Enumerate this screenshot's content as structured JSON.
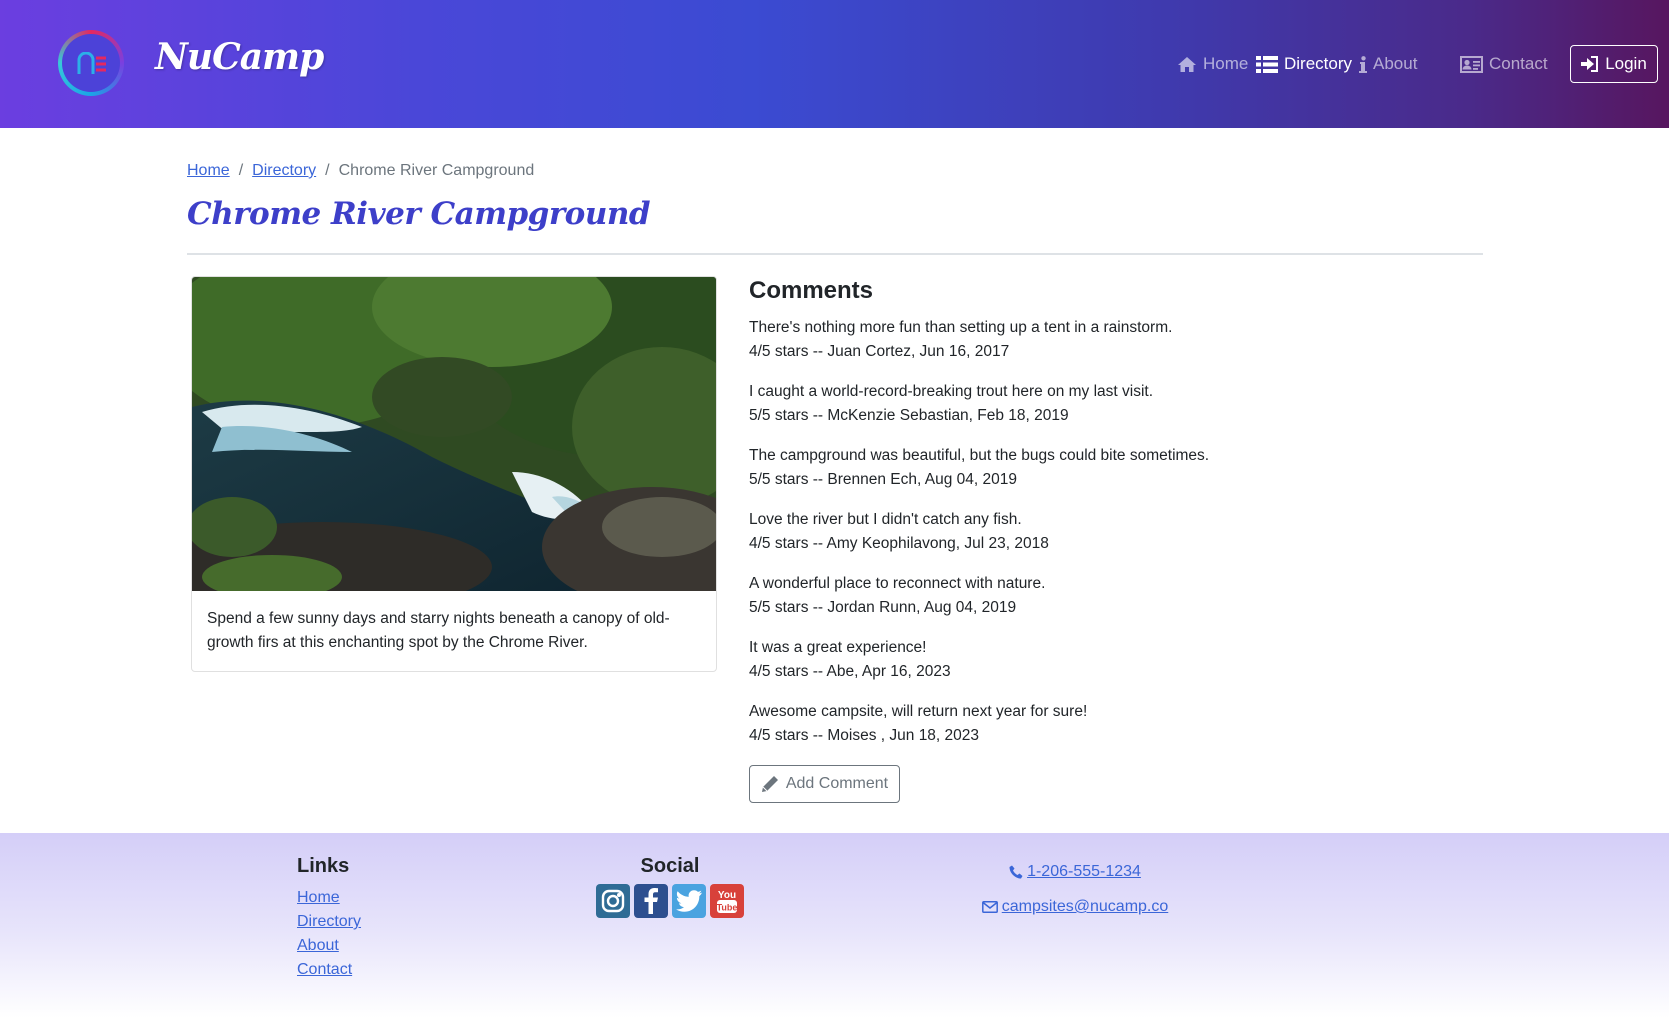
{
  "brand": {
    "name": "NuCamp"
  },
  "nav": {
    "items": [
      {
        "label": "Home",
        "icon": "home-icon",
        "active": false
      },
      {
        "label": "Directory",
        "icon": "list-icon",
        "active": true
      },
      {
        "label": "About",
        "icon": "info-icon",
        "active": false
      },
      {
        "label": "Contact",
        "icon": "address-card-icon",
        "active": false
      }
    ],
    "login_label": "Login"
  },
  "breadcrumb": {
    "home": "Home",
    "directory": "Directory",
    "current": "Chrome River Campground",
    "separator": "/"
  },
  "campsite": {
    "name": "Chrome River Campground",
    "description": "Spend a few sunny days and starry nights beneath a canopy of old-growth firs at this enchanting spot by the Chrome River."
  },
  "comments": {
    "heading": "Comments",
    "items": [
      {
        "text": "There's nothing more fun than setting up a tent in a rainstorm.",
        "meta": "4/5 stars -- Juan Cortez, Jun 16, 2017"
      },
      {
        "text": "I caught a world-record-breaking trout here on my last visit.",
        "meta": "5/5 stars -- McKenzie Sebastian, Feb 18, 2019"
      },
      {
        "text": "The campground was beautiful, but the bugs could bite sometimes.",
        "meta": "5/5 stars -- Brennen Ech, Aug 04, 2019"
      },
      {
        "text": "Love the river but I didn't catch any fish.",
        "meta": "4/5 stars -- Amy Keophilavong, Jul 23, 2018"
      },
      {
        "text": "A wonderful place to reconnect with nature.",
        "meta": "5/5 stars -- Jordan Runn, Aug 04, 2019"
      },
      {
        "text": "It was a great experience!",
        "meta": "4/5 stars -- Abe, Apr 16, 2023"
      },
      {
        "text": "Awesome campsite, will return next year for sure!",
        "meta": "4/5 stars -- Moises , Jun 18, 2023"
      }
    ],
    "add_label": "Add Comment"
  },
  "footer": {
    "links_heading": "Links",
    "links": [
      "Home",
      "Directory",
      "About",
      "Contact"
    ],
    "social_heading": "Social",
    "social": [
      {
        "name": "instagram-icon",
        "color": "#2f6c95"
      },
      {
        "name": "facebook-icon",
        "color": "#2d4f8f"
      },
      {
        "name": "twitter-icon",
        "color": "#4aa3e0"
      },
      {
        "name": "youtube-icon",
        "color": "#d8413a"
      }
    ],
    "phone": "1-206-555-1234",
    "email": "campsites@nucamp.co"
  },
  "colors": {
    "accent": "#3d3fc9",
    "link": "#3b66d8"
  }
}
